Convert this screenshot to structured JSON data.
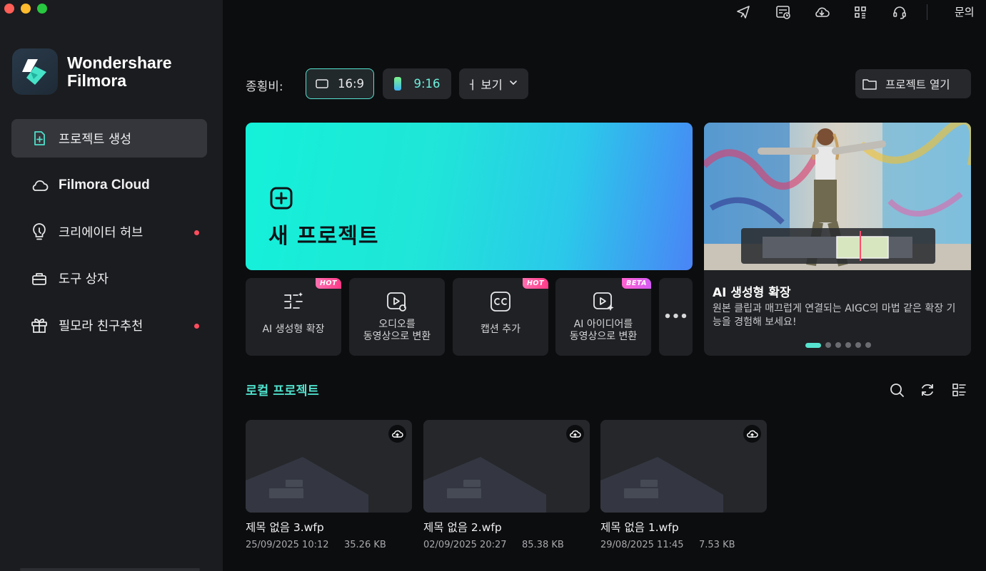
{
  "app": {
    "brand_line1": "Wondershare",
    "brand_line2": "Filmora"
  },
  "sidebar": {
    "items": [
      {
        "label": "프로젝트 생성",
        "icon": "plus-square-icon",
        "active": true
      },
      {
        "label": "Filmora Cloud",
        "icon": "cloud-icon"
      },
      {
        "label": "크리에이터 허브",
        "icon": "lightbulb-icon",
        "notify": true
      },
      {
        "label": "도구 상자",
        "icon": "toolbox-icon"
      },
      {
        "label": "필모라 친구추천",
        "icon": "gift-icon",
        "notify": true
      }
    ]
  },
  "topbar": {
    "icons": [
      "send-icon",
      "calendar-clock-icon",
      "cloud-download-icon",
      "grid-icon",
      "headset-icon"
    ],
    "contact_label": "문의"
  },
  "aspect": {
    "label": "종횡비:",
    "options": [
      "16:9",
      "9:16"
    ],
    "selected": "16:9",
    "more_label": "ㅓ 보기"
  },
  "open_project_label": "프로젝트 열기",
  "new_project": {
    "label": "새 프로젝트"
  },
  "features": [
    {
      "label": "AI 생성형 확장",
      "icon": "ai-extend-icon",
      "badge": "HOT"
    },
    {
      "label": "오디오를\n동영상으로 변환",
      "icon": "audio-to-video-icon"
    },
    {
      "label": "캡션 추가",
      "icon": "cc-icon",
      "badge": "HOT"
    },
    {
      "label": "AI 아이디어를\n동영상으로 변환",
      "icon": "ai-idea-video-icon",
      "badge": "BETA"
    }
  ],
  "more_label": "•••",
  "promo": {
    "title": "AI 생성형 확장",
    "description": "원본 클립과 매끄럽게 연결되는 AIGC의 마법 같은 확장 기능을 경험해 보세요!",
    "slide_count": 6,
    "active_slide": 1
  },
  "local": {
    "title": "로컬 프로젝트",
    "projects": [
      {
        "name": "제목 없음 3.wfp",
        "date": "25/09/2025 10:12",
        "size": "35.26 KB"
      },
      {
        "name": "제목 없음 2.wfp",
        "date": "02/09/2025 20:27",
        "size": "85.38 KB"
      },
      {
        "name": "제목 없음 1.wfp",
        "date": "29/08/2025 11:45",
        "size": "7.53 KB"
      }
    ]
  },
  "colors": {
    "accent": "#56e3cf",
    "notify": "#ff4d5e",
    "sidebar_bg": "#1b1c1f",
    "main_bg": "#0c0d0f"
  }
}
